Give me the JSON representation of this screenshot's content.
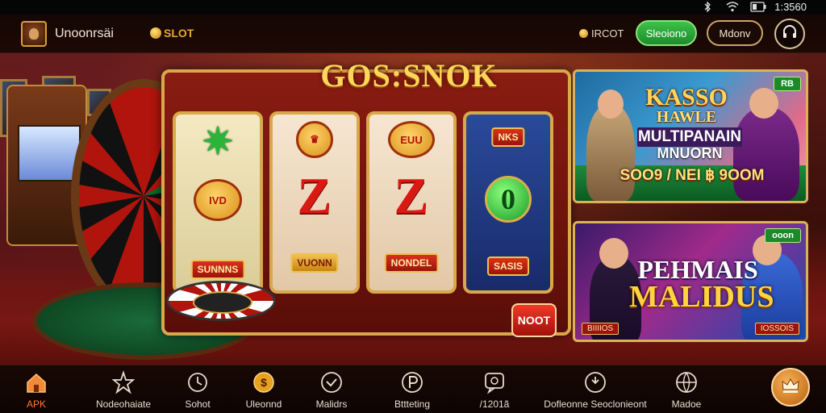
{
  "status_bar": {
    "time": "1:3560"
  },
  "header": {
    "app_name": "Unoonrsäi",
    "slot_tab": "SLOT",
    "balance": "IRCOT",
    "primary_button": "Sleoiono",
    "secondary_button": "Mdonv"
  },
  "main": {
    "game_title": "GOS:SNOK",
    "spin_button": "NOOT",
    "reels": [
      {
        "top": "",
        "middle": "IVD",
        "bottom": "SUNNNS"
      },
      {
        "top": "",
        "middle": "Z",
        "bottom": "VUONN"
      },
      {
        "top": "EUU",
        "middle": "Z",
        "bottom": "NONDEL"
      },
      {
        "top": "NKS",
        "middle": "0",
        "bottom": "SASIS"
      }
    ]
  },
  "promos": [
    {
      "tag": "RB",
      "line1": "KASSO",
      "line2": "HAWLE",
      "line3": "MULTIPANAIN",
      "line4": "MNUORN",
      "winnings": "SOO9 / NEI ฿ 9OOM"
    },
    {
      "tag": "ooon",
      "line1": "PEHMAIS",
      "line2": "MALIDUS",
      "footer_left": "BIIIIOS",
      "footer_right": "IOSSOIS"
    }
  ],
  "bottom_nav": [
    {
      "label": "APK",
      "icon": "home-icon",
      "active": true
    },
    {
      "label": "Nodeohaiate",
      "icon": "star-icon",
      "active": false
    },
    {
      "label": "Sohot",
      "icon": "clock-icon",
      "active": false
    },
    {
      "label": "Uleonnd",
      "icon": "coin-icon",
      "active": false
    },
    {
      "label": "Malidrs",
      "icon": "checkmark-icon",
      "active": false
    },
    {
      "label": "Bttteting",
      "icon": "parking-icon",
      "active": false
    },
    {
      "label": "/1201ã",
      "icon": "chat-icon",
      "active": false
    },
    {
      "label": "Dofleonne Seoclonieont",
      "icon": "gauge-icon",
      "active": false
    },
    {
      "label": "Madoe",
      "icon": "globe-icon",
      "active": false
    }
  ],
  "fab_icon": "crown-icon",
  "colors": {
    "accent_gold": "#d9a84a",
    "active_nav": "#ff7a3a",
    "green_button": "#2aa63a",
    "reel_red": "#d81a12"
  }
}
